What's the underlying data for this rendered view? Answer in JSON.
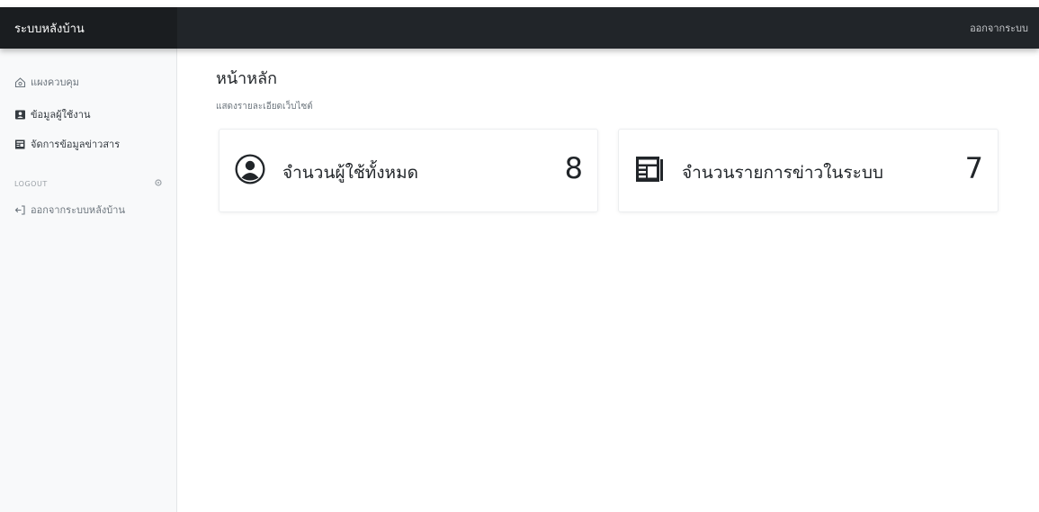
{
  "topbar": {
    "brand": "ระบบหลังบ้าน",
    "signout_label": "ออกจากระบบ"
  },
  "sidebar": {
    "items": [
      {
        "label": "แผงควบคุม",
        "icon": "dashboard-icon"
      },
      {
        "label": "ข้อมูลผู้ใช้งาน",
        "icon": "user-card-icon"
      },
      {
        "label": "จัดการข้อมูลข่าวสาร",
        "icon": "newspaper-icon"
      }
    ],
    "section_heading": "LOGOUT",
    "logout_item": {
      "label": "ออกจากระบบหลังบ้าน",
      "icon": "logout-icon"
    }
  },
  "main": {
    "title": "หน้าหลัก",
    "subtitle": "แสดงรายละเอียดเว็บไซต์",
    "cards": [
      {
        "label": "จำนวนผู้ใช้ทั้งหมด",
        "value": "8",
        "icon": "user-circle-icon"
      },
      {
        "label": "จำนวนรายการข่าวในระบบ",
        "value": "7",
        "icon": "newspaper-icon"
      }
    ]
  },
  "colors": {
    "topbar_bg": "#212529",
    "brand_bg": "#1a1d20",
    "sidebar_bg": "#f8f9fa",
    "text_dark": "#212529",
    "text_muted": "#6c757d"
  }
}
